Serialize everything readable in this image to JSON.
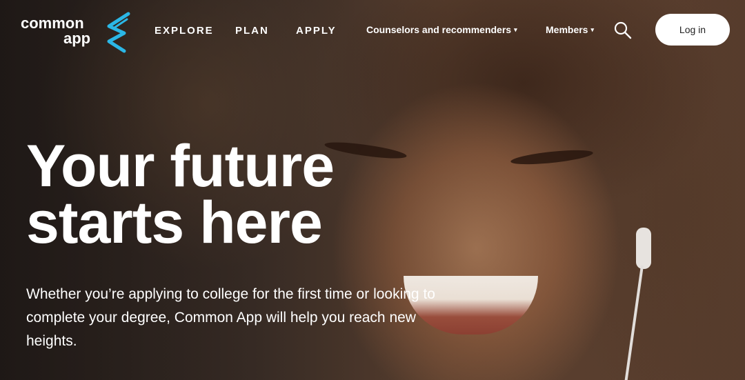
{
  "brand": {
    "logo_word1": "common",
    "logo_word2": "app",
    "accent_color": "#2bb7e6"
  },
  "nav": {
    "explore": "EXPLORE",
    "plan": "PLAN",
    "apply": "APPLY",
    "counselors": "Counselors and recommenders",
    "members": "Members",
    "caret_glyph": "▾",
    "search_icon": "search-icon",
    "login": "Log in"
  },
  "hero": {
    "title_line1": "Your future",
    "title_line2": "starts here",
    "subtitle": "Whether you’re applying to college for the first time or looking to complete your degree, Common App will help you reach new heights."
  }
}
